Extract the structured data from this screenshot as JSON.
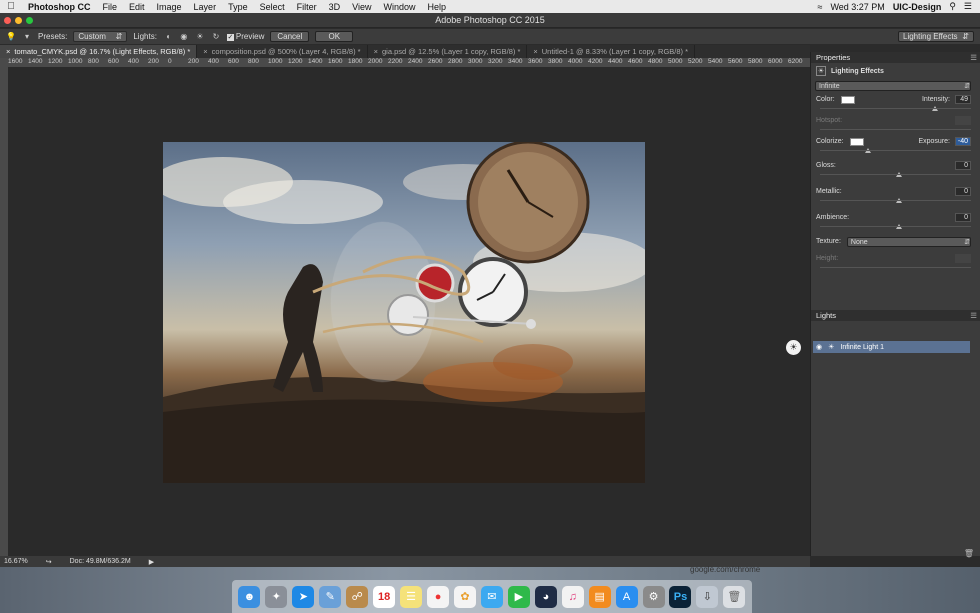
{
  "menubar": {
    "apple": "",
    "app": "Photoshop CC",
    "items": [
      "File",
      "Edit",
      "Image",
      "Layer",
      "Type",
      "Select",
      "Filter",
      "3D",
      "View",
      "Window",
      "Help"
    ],
    "clock": "Wed 3:27 PM",
    "user": "UIC-Design"
  },
  "window": {
    "title": "Adobe Photoshop CC 2015"
  },
  "options": {
    "presets_label": "Presets:",
    "presets_value": "Custom",
    "lights_label": "Lights:",
    "preview_label": "Preview",
    "cancel_label": "Cancel",
    "ok_label": "OK",
    "workspace": "Lighting Effects"
  },
  "tabs": [
    {
      "label": "tomato_CMYK.psd @ 16.7% (Light Effects, RGB/8) *"
    },
    {
      "label": "composition.psd @ 500% (Layer 4, RGB/8) *"
    },
    {
      "label": "gia.psd @ 12.5% (Layer 1 copy, RGB/8) *"
    },
    {
      "label": "Untitled-1 @ 8.33% (Layer 1 copy, RGB/8) *"
    }
  ],
  "ruler": [
    "1600",
    "1400",
    "1200",
    "1000",
    "800",
    "600",
    "400",
    "200",
    "0",
    "200",
    "400",
    "600",
    "800",
    "1000",
    "1200",
    "1400",
    "1600",
    "1800",
    "2000",
    "2200",
    "2400",
    "2600",
    "2800",
    "3000",
    "3200",
    "3400",
    "3600",
    "3800",
    "4000",
    "4200",
    "4400",
    "4600",
    "4800",
    "5000",
    "5200",
    "5400",
    "5600",
    "5800",
    "6000",
    "6200"
  ],
  "status": {
    "zoom": "16.67%",
    "doc": "Doc: 49.8M/636.2M"
  },
  "properties": {
    "tab": "Properties",
    "header": "Lighting Effects",
    "light_type": "Infinite",
    "color_label": "Color:",
    "intensity_label": "Intensity:",
    "intensity_value": "49",
    "hotspot_label": "Hotspot:",
    "colorize_label": "Colorize:",
    "exposure_label": "Exposure:",
    "exposure_value": "-40",
    "gloss_label": "Gloss:",
    "gloss_value": "0",
    "metallic_label": "Metallic:",
    "metallic_value": "0",
    "ambience_label": "Ambience:",
    "ambience_value": "0",
    "texture_label": "Texture:",
    "texture_value": "None",
    "height_label": "Height:"
  },
  "lights": {
    "tab": "Lights",
    "item": "Infinite Light 1"
  },
  "browser": {
    "url": "google.com/chrome"
  },
  "calendar_day": "18",
  "colors": {
    "selection": "#5b7293",
    "accent": "#2e5c9a"
  }
}
